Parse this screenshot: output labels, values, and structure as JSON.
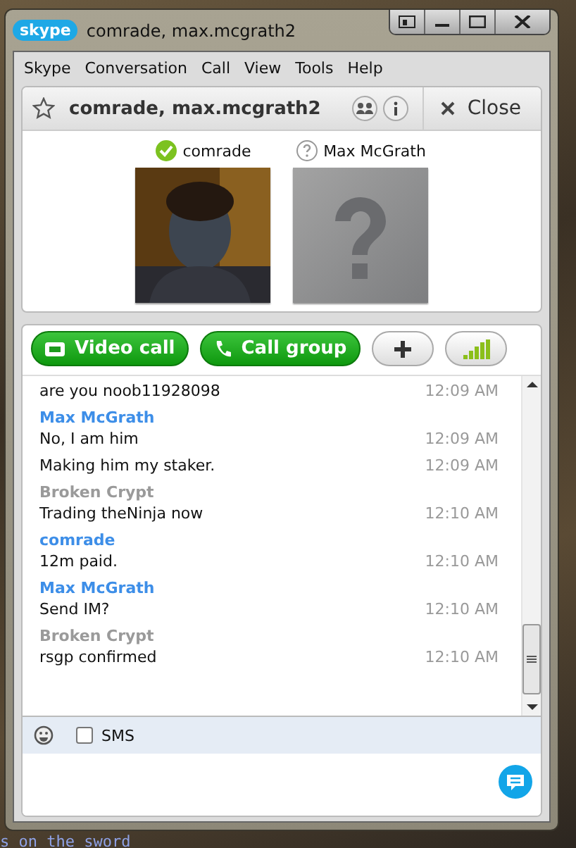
{
  "window": {
    "logo": "skype",
    "title": "comrade, max.mcgrath2"
  },
  "menu": [
    "Skype",
    "Conversation",
    "Call",
    "View",
    "Tools",
    "Help"
  ],
  "header": {
    "title": "comrade, max.mcgrath2",
    "close_label": "Close"
  },
  "participants": [
    {
      "name": "comrade",
      "online": true,
      "kind": "picture"
    },
    {
      "name": "Max McGrath",
      "online": false,
      "kind": "placeholder"
    }
  ],
  "toolbar": [
    {
      "kind": "video",
      "label": "Video call"
    },
    {
      "kind": "call",
      "label": "Call group"
    },
    {
      "kind": "add"
    },
    {
      "kind": "signal"
    }
  ],
  "messages": [
    {
      "text": "are you noob11928098",
      "time": "12:09 AM"
    },
    {
      "sender": "Max McGrath",
      "color": "#3d8ee8",
      "text": "No, I am him",
      "time": "12:09 AM"
    },
    {
      "text": "Making him my staker.",
      "time": "12:09 AM"
    },
    {
      "sender": "Broken Crypt",
      "color": "#9a9a9a",
      "text": "Trading theNinja now",
      "time": "12:10 AM"
    },
    {
      "sender": "comrade",
      "color": "#3d8ee8",
      "text": "12m paid.",
      "time": "12:10 AM"
    },
    {
      "sender": "Max McGrath",
      "color": "#3d8ee8",
      "text": "Send IM?",
      "time": "12:10 AM"
    },
    {
      "sender": "Broken Crypt",
      "color": "#9a9a9a",
      "text": "rsgp confirmed",
      "time": "12:10 AM"
    }
  ],
  "compose": {
    "sms_label": "SMS",
    "sms_checked": false
  },
  "desktop_text": "s on the sword"
}
